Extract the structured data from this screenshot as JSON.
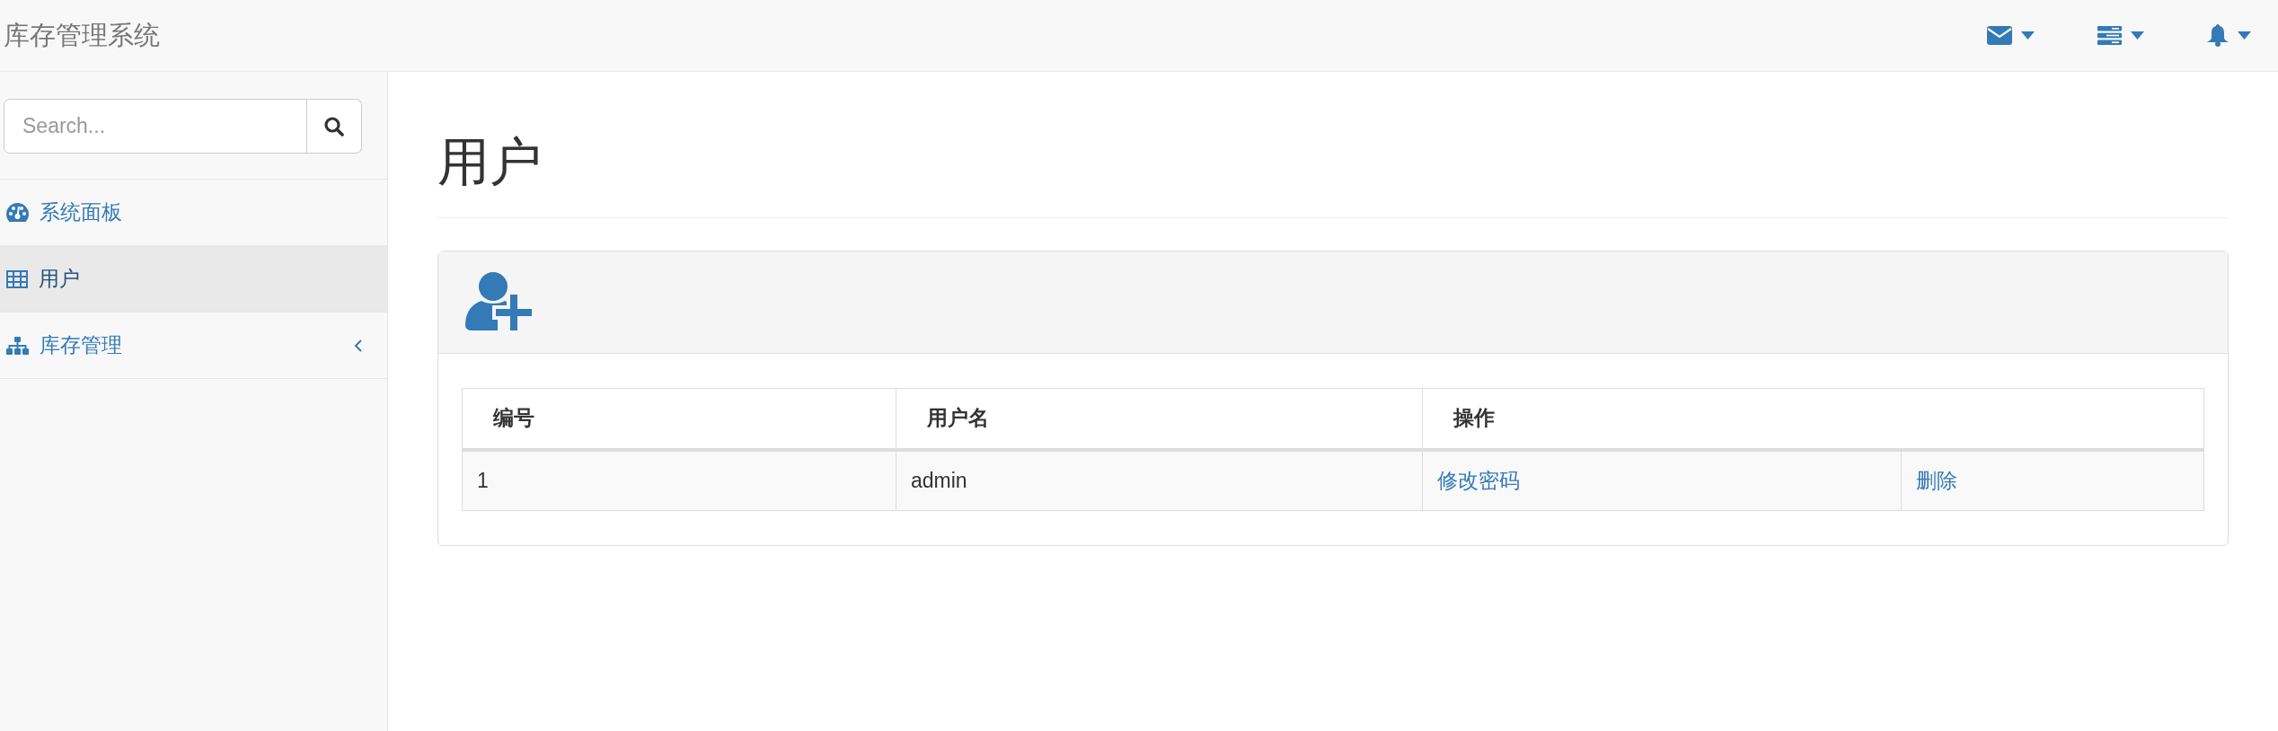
{
  "navbar": {
    "brand": "库存管理系统",
    "menus": [
      {
        "kind": "envelope",
        "expanded": false
      },
      {
        "kind": "tasks",
        "expanded": false
      },
      {
        "kind": "bell",
        "expanded": false
      }
    ]
  },
  "sidebar": {
    "search": {
      "placeholder": "Search..."
    },
    "items": [
      {
        "label": "系统面板",
        "kind": "dashboard",
        "selected": false
      },
      {
        "label": "用户",
        "kind": "table",
        "selected": true
      },
      {
        "label": "库存管理",
        "kind": "sitemap",
        "selected": false,
        "expanded": false
      }
    ]
  },
  "page": {
    "title": "用户"
  },
  "panel": {
    "table": {
      "columns": [
        {
          "label": "编号"
        },
        {
          "label": "用户名"
        },
        {
          "label": "操作",
          "colspan": 2
        }
      ],
      "rows": [
        {
          "cells": [
            {
              "text": "1",
              "kind": "text"
            },
            {
              "text": "admin",
              "kind": "text"
            },
            {
              "text": "修改密码",
              "kind": "link"
            },
            {
              "text": "删除",
              "kind": "link"
            }
          ]
        }
      ]
    }
  }
}
